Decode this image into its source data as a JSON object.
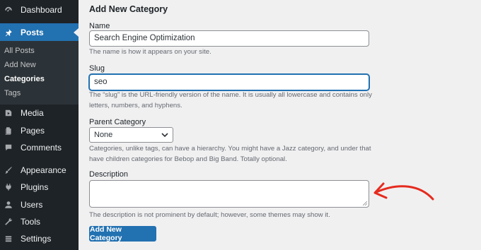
{
  "sidebar": {
    "top_items": [
      {
        "label": "Dashboard",
        "icon": "dashboard-icon"
      },
      {
        "label": "Posts",
        "icon": "pin-icon",
        "active": true
      }
    ],
    "posts_submenu": [
      "All Posts",
      "Add New",
      "Categories",
      "Tags"
    ],
    "bottom_items": [
      {
        "label": "Media",
        "icon": "media-icon"
      },
      {
        "label": "Pages",
        "icon": "pages-icon"
      },
      {
        "label": "Comments",
        "icon": "comments-icon"
      },
      {
        "label": "Appearance",
        "icon": "brush-icon"
      },
      {
        "label": "Plugins",
        "icon": "plugins-icon"
      },
      {
        "label": "Users",
        "icon": "users-icon"
      },
      {
        "label": "Tools",
        "icon": "wrench-icon"
      },
      {
        "label": "Settings",
        "icon": "settings-icon"
      }
    ]
  },
  "form": {
    "heading": "Add New Category",
    "name": {
      "label": "Name",
      "value": "Search Engine Optimization",
      "help": "The name is how it appears on your site."
    },
    "slug": {
      "label": "Slug",
      "value": "seo",
      "help": "The “slug” is the URL-friendly version of the name. It is usually all lowercase and contains only letters, numbers, and hyphens."
    },
    "parent": {
      "label": "Parent Category",
      "selected": "None",
      "help": "Categories, unlike tags, can have a hierarchy. You might have a Jazz category, and under that have children categories for Bebop and Big Band. Totally optional."
    },
    "description": {
      "label": "Description",
      "value": "",
      "help": "The description is not prominent by default; however, some themes may show it."
    },
    "submit_label": "Add New Category"
  },
  "colors": {
    "sidebar_bg": "#1d2327",
    "accent": "#2271b1",
    "annotation": "#e52b1e"
  }
}
